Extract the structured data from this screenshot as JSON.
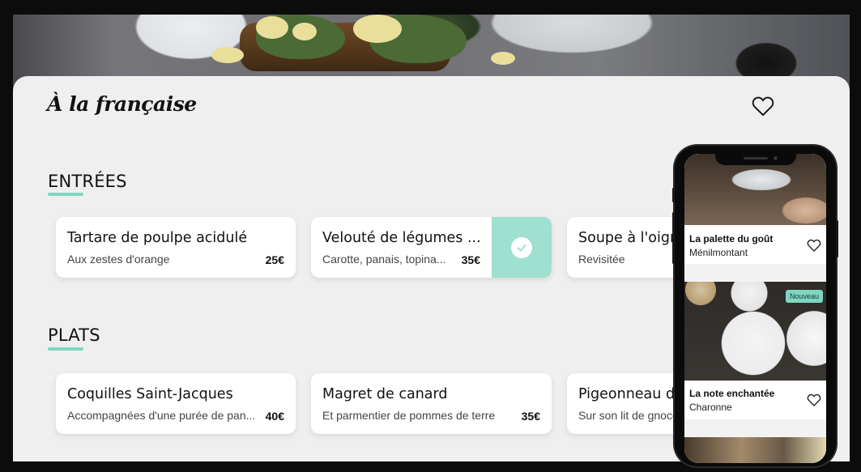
{
  "brand": {
    "title": "À la française"
  },
  "sections": [
    {
      "title": "ENTRÉES",
      "dishes": [
        {
          "name": "Tartare de poulpe acidulé",
          "description": "Aux zestes d'orange",
          "price": "25€",
          "selected": false
        },
        {
          "name": "Velouté de légumes ...",
          "description": "Carotte, panais, topina...",
          "price": "35€",
          "selected": true
        },
        {
          "name": "Soupe à l'oignon",
          "description": "Revisitée",
          "price": "",
          "selected": false
        }
      ]
    },
    {
      "title": "PLATS",
      "dishes": [
        {
          "name": "Coquilles Saint-Jacques",
          "description": "Accompagnées d'une purée de pan...",
          "price": "40€",
          "selected": false
        },
        {
          "name": "Magret de canard",
          "description": "Et parmentier de pommes de terre",
          "price": "35€",
          "selected": false
        },
        {
          "name": "Pigeonneau d'Ile",
          "description": "Sur son lit de gnocchi",
          "price": "",
          "selected": false
        }
      ]
    }
  ],
  "phone": {
    "restaurants": [
      {
        "name": "La palette du goût",
        "area": "Ménilmontant",
        "badge": ""
      },
      {
        "name": "La note enchantée",
        "area": "Charonne",
        "badge": "Nouveau"
      }
    ]
  },
  "icons": {
    "favorite": "heart-icon",
    "selected": "check-icon"
  },
  "colors": {
    "accent": "#7ed6c1",
    "selected_bg": "#9fe0d0",
    "page_bg": "#efefef"
  }
}
